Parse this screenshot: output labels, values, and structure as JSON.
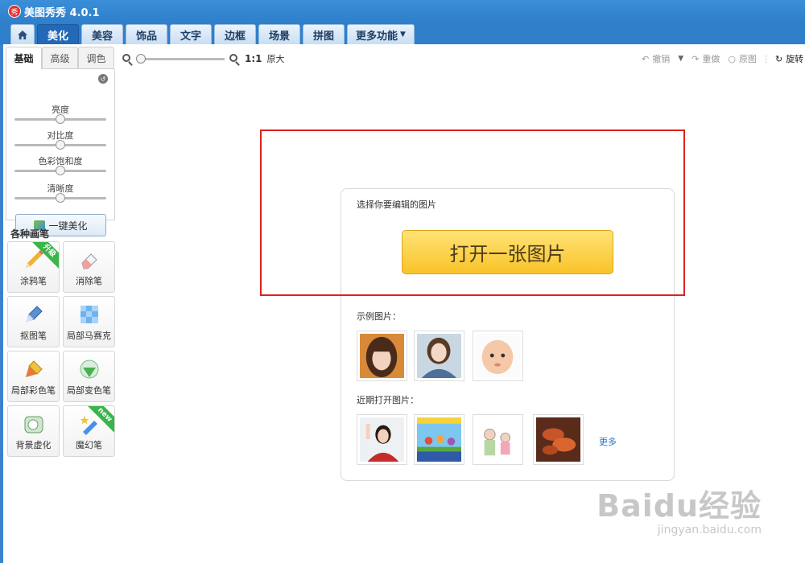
{
  "app": {
    "title": "美图秀秀 4.0.1",
    "logo_text": "秀"
  },
  "tabs": [
    {
      "label": "美化",
      "active": true
    },
    {
      "label": "美容"
    },
    {
      "label": "饰品"
    },
    {
      "label": "文字"
    },
    {
      "label": "边框"
    },
    {
      "label": "场景"
    },
    {
      "label": "拼图"
    },
    {
      "label": "更多功能"
    }
  ],
  "left_panel": {
    "subtabs": [
      "基础",
      "高级",
      "调色"
    ],
    "sliders": [
      {
        "label": "亮度",
        "value": 0.5
      },
      {
        "label": "对比度",
        "value": 0.5
      },
      {
        "label": "色彩饱和度",
        "value": 0.5
      },
      {
        "label": "清晰度",
        "value": 0.5
      }
    ],
    "one_key_label": "一键美化",
    "brush_title": "各种画笔",
    "brushes": [
      {
        "label": "涂鸦笔",
        "ribbon": "升级",
        "icon": "pencil-icon"
      },
      {
        "label": "消除笔",
        "icon": "eraser-icon"
      },
      {
        "label": "抠图笔",
        "icon": "cutout-pen-icon"
      },
      {
        "label": "局部马赛克",
        "icon": "mosaic-icon"
      },
      {
        "label": "局部彩色笔",
        "icon": "color-brush-icon"
      },
      {
        "label": "局部变色笔",
        "icon": "recolor-brush-icon"
      },
      {
        "label": "背景虚化",
        "icon": "blur-icon"
      },
      {
        "label": "魔幻笔",
        "ribbon": "new",
        "icon": "magic-pen-icon"
      }
    ]
  },
  "toolbar": {
    "zoom_ratio": "1:1",
    "zoom_orig": "原大",
    "undo": "撤销",
    "redo": "重做",
    "original": "原图",
    "rotate": "旋转"
  },
  "dialog": {
    "prompt": "选择你要编辑的图片",
    "open_button": "打开一张图片",
    "sample_label": "示例图片：",
    "recent_label": "近期打开图片：",
    "more_link": "更多"
  },
  "watermark": {
    "main": "Baidu经验",
    "sub": "jingyan.baidu.com"
  }
}
